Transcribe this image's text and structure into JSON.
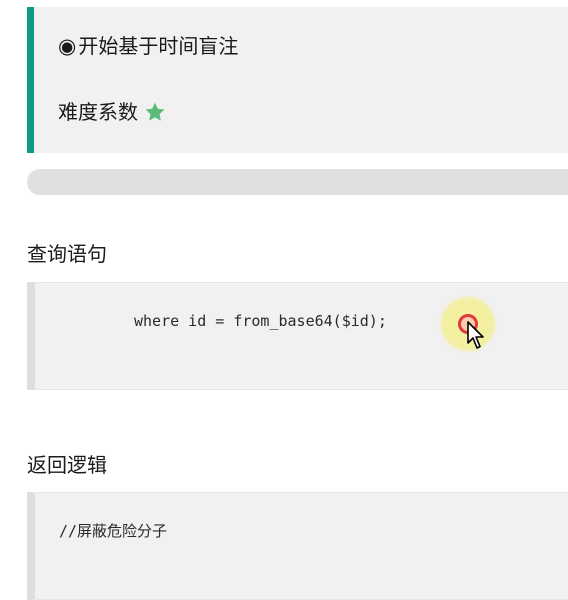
{
  "panel": {
    "title_bullet": "◉",
    "title": "开始基于时间盲注",
    "difficulty_label": "难度系数",
    "difficulty_icon": "star-icon",
    "difficulty_stars": 1,
    "accent_color": "#0f9a88",
    "star_color": "#5dbb7a"
  },
  "progress": {
    "value": 0
  },
  "sections": {
    "query": {
      "title": "查询语句",
      "code": "where id = from_base64($id);"
    },
    "return": {
      "title": "返回逻辑",
      "code": "//屏蔽危险分子"
    }
  },
  "cursor": {
    "icon": "mouse-pointer-icon"
  }
}
